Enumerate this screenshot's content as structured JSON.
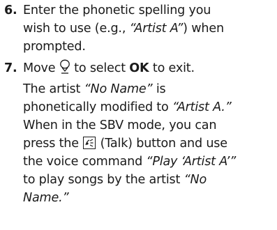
{
  "steps": [
    {
      "number": "6.",
      "lines": {
        "l1": "Enter the phonetic spelling you",
        "l2a": "wish to use (e.g., ",
        "l2b": "“Artist A”",
        "l2c": ") when",
        "l3": "prompted."
      }
    },
    {
      "number": "7.",
      "lines": {
        "l1a": "Move ",
        "l1b": " to select ",
        "l1c": "OK",
        "l1d": " to exit.",
        "l2a": "The artist ",
        "l2b": "“No Name”",
        "l2c": " is",
        "l3a": "phonetically modified to ",
        "l3b": "“Artist A.”",
        "l4": "When in the SBV mode, you can",
        "l5a": "press the ",
        "l5b": " (Talk) button and use",
        "l6a": "the voice command ",
        "l6b": "“Play ‘Artist A’”",
        "l7a": "to play songs by the artist ",
        "l7b": "“No",
        "l8": "Name.”"
      }
    }
  ],
  "icons": {
    "joystick": "joystick-down-icon",
    "talk": "talk-button-icon"
  }
}
